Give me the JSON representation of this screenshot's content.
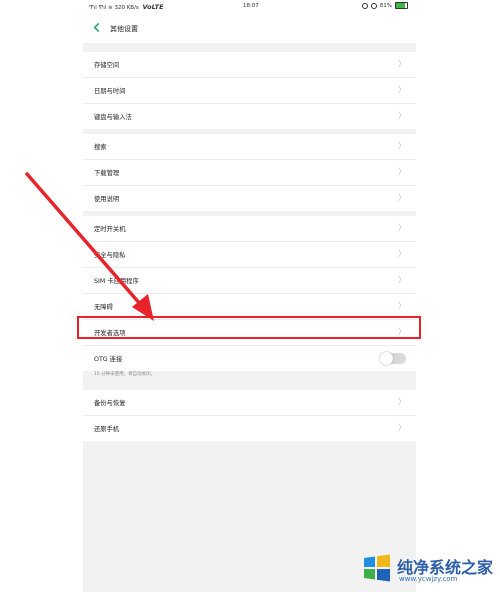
{
  "statusbar": {
    "left_text": "Ͳıl Ͳıl ≋ 320 KB/s",
    "volte": "VoLTE",
    "time": "18:07",
    "battery": "81%",
    "battery_level": 0.81
  },
  "header": {
    "title": "其他设置"
  },
  "groups": [
    {
      "items": [
        "存储空间",
        "日期与时间",
        "键盘与输入法"
      ]
    },
    {
      "items": [
        "搜索",
        "下载管理",
        "使用说明"
      ]
    },
    {
      "items": [
        "定时开关机",
        "安全与隐私",
        "SIM 卡应用程序",
        "无障碍",
        "开发者选项"
      ]
    }
  ],
  "otg": {
    "label": "OTG 连接",
    "note": "10 分钟未使用，将自动关闭。",
    "enabled": false
  },
  "group_backup": {
    "items": [
      "备份与恢复",
      "还原手机"
    ]
  },
  "chevron": "〉",
  "colors": {
    "highlight": "#e8232a",
    "back_arrow": "#2aa776"
  },
  "watermark": {
    "title": "纯净系统之家",
    "url": "www.ycwjzy.com"
  }
}
